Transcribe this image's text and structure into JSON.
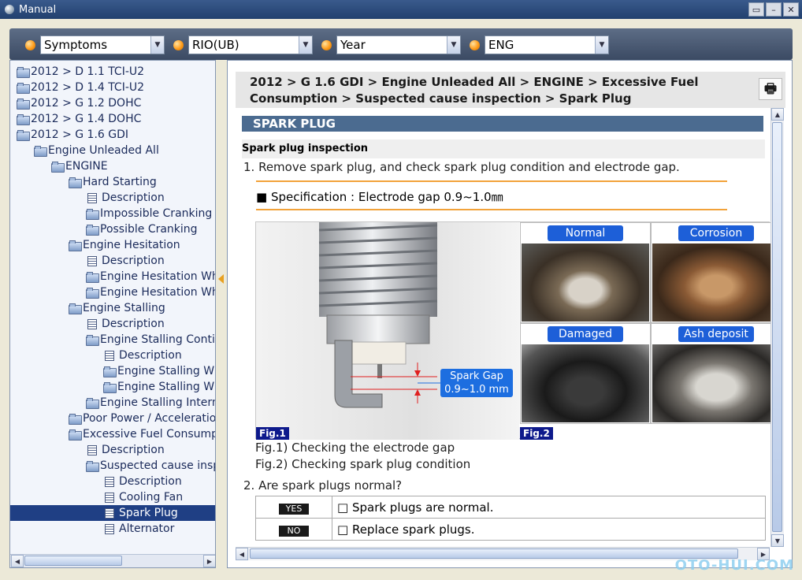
{
  "window": {
    "title": "Manual"
  },
  "toolbar": {
    "combos": [
      {
        "value": "Symptoms"
      },
      {
        "value": "RIO(UB)"
      },
      {
        "value": "Year"
      },
      {
        "value": "ENG"
      }
    ]
  },
  "tree": {
    "nodes": [
      {
        "label": "2012 > D 1.1 TCI-U2",
        "type": "folder",
        "level": 0
      },
      {
        "label": "2012 > D 1.4 TCI-U2",
        "type": "folder",
        "level": 0
      },
      {
        "label": "2012 > G 1.2 DOHC",
        "type": "folder",
        "level": 0
      },
      {
        "label": "2012 > G 1.4 DOHC",
        "type": "folder",
        "level": 0
      },
      {
        "label": "2012 > G 1.6 GDI",
        "type": "folder",
        "level": 0
      },
      {
        "label": "Engine Unleaded All",
        "type": "folder",
        "level": 1
      },
      {
        "label": "ENGINE",
        "type": "folder",
        "level": 2
      },
      {
        "label": "Hard Starting",
        "type": "folder",
        "level": 3
      },
      {
        "label": "Description",
        "type": "doc",
        "level": 4
      },
      {
        "label": "Impossible Cranking",
        "type": "folder",
        "level": 4
      },
      {
        "label": "Possible Cranking",
        "type": "folder",
        "level": 4
      },
      {
        "label": "Engine Hesitation",
        "type": "folder",
        "level": 3
      },
      {
        "label": "Description",
        "type": "doc",
        "level": 4
      },
      {
        "label": "Engine Hesitation Whe",
        "type": "folder",
        "level": 4
      },
      {
        "label": "Engine Hesitation Whe",
        "type": "folder",
        "level": 4
      },
      {
        "label": "Engine Stalling",
        "type": "folder",
        "level": 3
      },
      {
        "label": "Description",
        "type": "doc",
        "level": 4
      },
      {
        "label": "Engine Stalling Contin",
        "type": "folder",
        "level": 4
      },
      {
        "label": "Description",
        "type": "doc",
        "level": 5
      },
      {
        "label": "Engine Stalling Wh",
        "type": "folder",
        "level": 5
      },
      {
        "label": "Engine Stalling Wh",
        "type": "folder",
        "level": 5
      },
      {
        "label": "Engine Stalling Intermi",
        "type": "folder",
        "level": 4
      },
      {
        "label": "Poor Power / Acceleratio",
        "type": "folder",
        "level": 3
      },
      {
        "label": "Excessive Fuel Consump",
        "type": "folder",
        "level": 3
      },
      {
        "label": "Description",
        "type": "doc",
        "level": 4
      },
      {
        "label": "Suspected cause insp",
        "type": "folder",
        "level": 4
      },
      {
        "label": "Description",
        "type": "doc",
        "level": 5
      },
      {
        "label": "Cooling Fan",
        "type": "doc",
        "level": 5
      },
      {
        "label": "Spark Plug",
        "type": "doc",
        "level": 5,
        "selected": true
      },
      {
        "label": "Alternator",
        "type": "doc",
        "level": 5
      }
    ]
  },
  "content": {
    "breadcrumb": "2012 > G 1.6 GDI > Engine Unleaded All > ENGINE > Excessive Fuel Consumption > Suspected cause inspection > Spark Plug",
    "section_title": "SPARK PLUG",
    "subheading": "Spark plug inspection",
    "step1": "1. Remove spark plug, and check spark plug condition and electrode gap.",
    "spec": "■ Specification : Electrode gap 0.9~1.0㎜",
    "figure": {
      "fig1_tag": "Fig.1",
      "fig2_tag": "Fig.2",
      "gap_label_line1": "Spark Gap",
      "gap_label_line2": "0.9~1.0 mm",
      "conditions": [
        "Normal",
        "Corrosion",
        "Damaged",
        "Ash deposit"
      ]
    },
    "caption1": "Fig.1) Checking the electrode gap",
    "caption2": "Fig.2) Checking spark plug condition",
    "step2": "2. Are spark plugs normal?",
    "answers": [
      {
        "key": "YES",
        "text": "Spark plugs are normal."
      },
      {
        "key": "NO",
        "text": "Replace spark plugs."
      }
    ]
  },
  "watermark": "OTO-HUI.COM",
  "colors": {
    "accent": "#1f3f84",
    "section": "#4b6b90",
    "spec_line": "#f2a23a",
    "label_blue": "#1d5fd8"
  }
}
